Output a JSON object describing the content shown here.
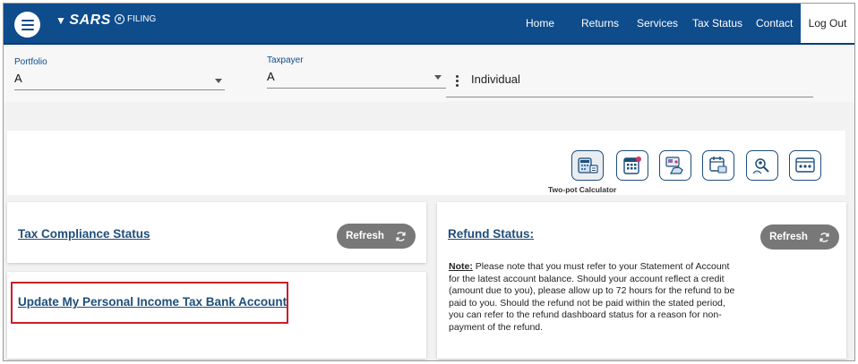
{
  "header": {
    "logo_sars": "SARS",
    "logo_efiling": "FILING",
    "nav": [
      {
        "label": "Home"
      },
      {
        "label": "Returns"
      },
      {
        "label": "Services"
      },
      {
        "label": "Tax Status"
      },
      {
        "label": "Contact"
      }
    ],
    "logout": "Log Out"
  },
  "selector": {
    "portfolio_label": "Portfolio",
    "portfolio_value": "A",
    "taxpayer_label": "Taxpayer",
    "taxpayer_value": "A",
    "taxpayer_type": "Individual"
  },
  "tools": {
    "active_label": "Two-pot Calculator",
    "icons": [
      "calculator-money-icon",
      "calendar-calc-icon",
      "payment-hand-icon",
      "calendar-folder-icon",
      "search-person-icon",
      "dashboard-icon"
    ]
  },
  "cards": {
    "tax_compliance": "Tax Compliance Status",
    "refresh_label": "Refresh",
    "update_bank": "Update My Personal Income Tax Bank Account",
    "refund_status": "Refund Status:",
    "note_label": "Note:",
    "note_text": " Please note that you must refer to your Statement of Account for the latest account balance. Should your account reflect a credit (amount due to you), please allow up to 72 hours for the refund to be paid to you. Should the refund not be paid within the stated period, you can refer to the refund dashboard status for a reason for non-payment of the refund."
  },
  "colors": {
    "header_blue": "#0e4c8c",
    "link_blue": "#1f4e7a",
    "refresh_grey": "#787878",
    "highlight_red": "#c8202a"
  }
}
